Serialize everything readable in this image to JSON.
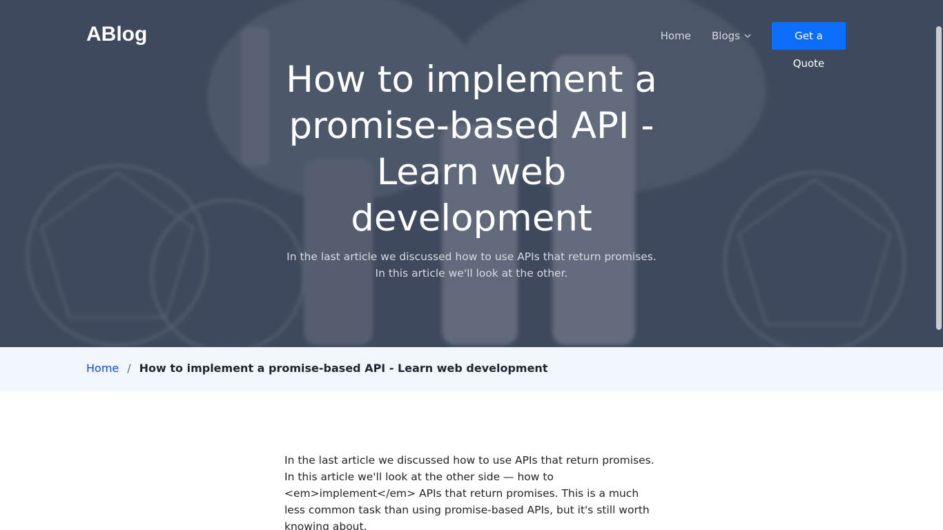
{
  "header": {
    "brand": "ABlog",
    "nav": {
      "home": "Home",
      "blogs": "Blogs",
      "cta": "Get a Quote"
    }
  },
  "hero": {
    "title": "How to implement a promise-based API - Learn web development",
    "subtitle": "In the last article we discussed how to use APIs that return promises. In this article we'll look at the other."
  },
  "breadcrumb": {
    "home": "Home",
    "separator": "/",
    "current": "How to implement a promise-based API - Learn web development"
  },
  "article": {
    "intro": "In the last article we discussed how to use APIs that return promises. In this article we'll look at the other side — how to <em>implement</em> APIs that return promises. This is a much less common task than using promise-based APIs, but it's still worth knowing about."
  },
  "colors": {
    "accent": "#0d6efd",
    "breadcrumb_bg": "#f1f5fc",
    "hero_overlay": "#3c4658"
  },
  "icons": {
    "blogs_dropdown": "chevron-down-icon"
  }
}
